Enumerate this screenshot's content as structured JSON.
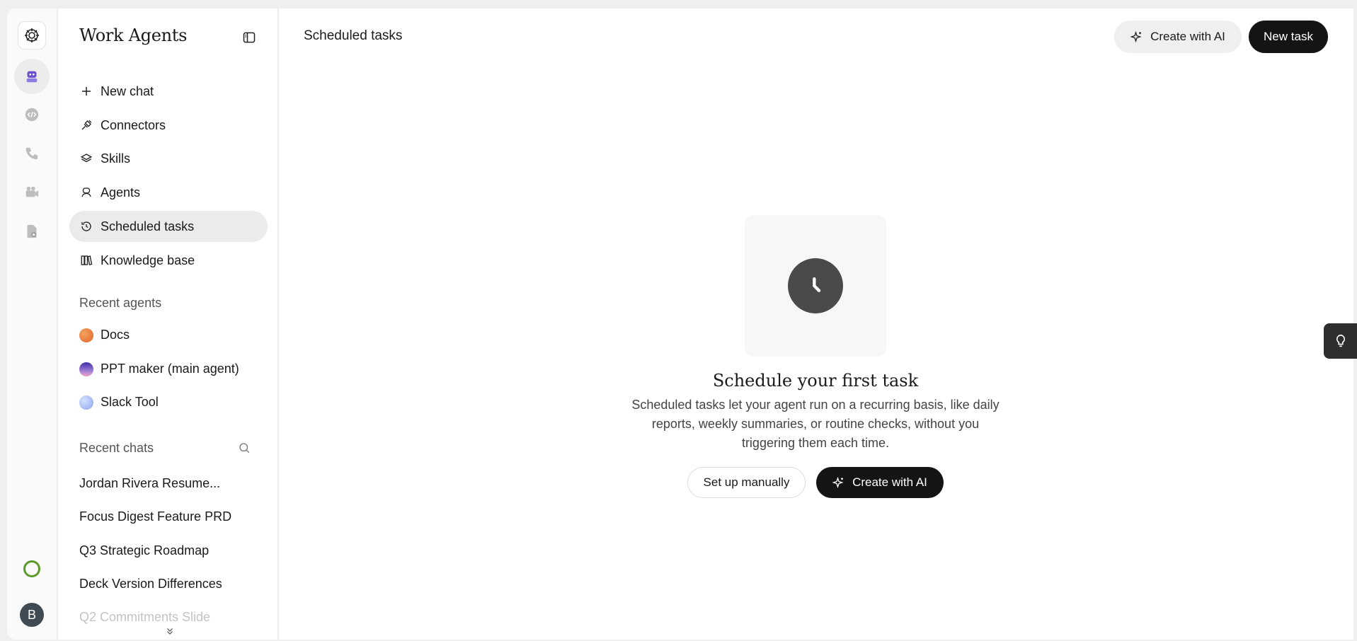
{
  "rail": {
    "icons": [
      "app-logo-icon",
      "agent-robot-icon",
      "code-icon",
      "phone-icon",
      "video-camera-icon",
      "document-icon"
    ],
    "avatar_initial": "B"
  },
  "sidebar": {
    "brand": "Work Agents",
    "nav": [
      {
        "label": "New chat",
        "icon": "plus-icon"
      },
      {
        "label": "Connectors",
        "icon": "plug-icon"
      },
      {
        "label": "Skills",
        "icon": "layers-icon"
      },
      {
        "label": "Agents",
        "icon": "agent-icon"
      },
      {
        "label": "Scheduled tasks",
        "icon": "clock-history-icon",
        "active": true
      },
      {
        "label": "Knowledge base",
        "icon": "books-icon"
      }
    ],
    "recent_agents_label": "Recent agents",
    "recent_agents": [
      {
        "label": "Docs",
        "color": "#e8743b"
      },
      {
        "label": "PPT maker (main agent)",
        "color": "#6a4fc8"
      },
      {
        "label": "Slack Tool",
        "color": "#9ab3f5"
      }
    ],
    "recent_chats_label": "Recent chats",
    "recent_chats": [
      "Jordan Rivera Resume...",
      "Focus Digest Feature PRD",
      "Q3 Strategic Roadmap",
      "Deck Version Differences",
      "Q2 Commitments Slide"
    ]
  },
  "main": {
    "title": "Scheduled tasks",
    "create_with_ai": "Create with AI",
    "new_task": "New task",
    "empty": {
      "title": "Schedule your first task",
      "description": "Scheduled tasks let your agent run on a recurring basis, like daily reports, weekly summaries, or routine checks, without you triggering them each time.",
      "setup_manually": "Set up manually",
      "create_with_ai": "Create with AI"
    }
  },
  "colors": {
    "accent_dark": "#141414",
    "status_green": "#5a9b2c",
    "active_bg": "#ebebeb"
  }
}
